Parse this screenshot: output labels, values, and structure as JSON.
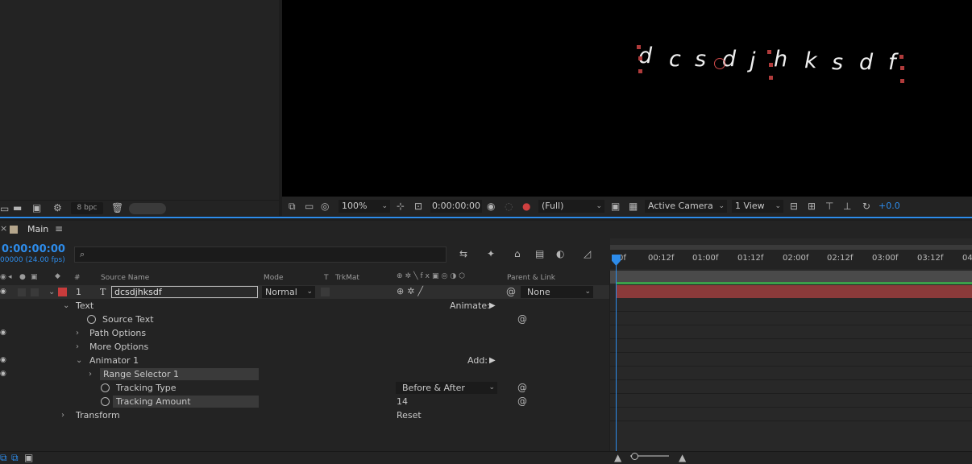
{
  "project": {
    "bpc_label": "8 bpc"
  },
  "viewer": {
    "text_chars": [
      "d",
      "c",
      "s",
      "d",
      "j",
      "h",
      "k",
      "s",
      "d",
      "f"
    ],
    "toolbar": {
      "zoom": "100%",
      "timecode": "0:00:00:00",
      "resolution": "(Full)",
      "camera": "Active Camera",
      "views": "1 View",
      "exposure": "+0.0"
    }
  },
  "timeline": {
    "tab_label": "Main",
    "current_time": "0:00:00:00",
    "fps_label": "00000 (24.00 fps)",
    "search_placeholder": "",
    "columns": {
      "hash": "#",
      "source_name": "Source Name",
      "mode": "Mode",
      "t": "T",
      "trkmat": "TrkMat",
      "parent": "Parent & Link"
    },
    "layer": {
      "number": "1",
      "type_glyph": "T",
      "name": "dcsdjhksdf",
      "mode": "Normal",
      "parent": "None"
    },
    "properties": {
      "text": "Text",
      "animate_label": "Animate:",
      "source_text": "Source Text",
      "path_options": "Path Options",
      "more_options": "More Options",
      "animator": "Animator 1",
      "add_label": "Add:",
      "range_selector": "Range Selector 1",
      "tracking_type": "Tracking Type",
      "tracking_type_value": "Before & After",
      "tracking_amount": "Tracking Amount",
      "tracking_amount_value": "14",
      "transform": "Transform",
      "reset_label": "Reset"
    },
    "ruler_labels": [
      "0f",
      "00:12f",
      "01:00f",
      "01:12f",
      "02:00f",
      "02:12f",
      "03:00f",
      "03:12f",
      "04"
    ]
  },
  "colors": {
    "accent": "#2d8ceb",
    "layer_label": "#c83c3c",
    "layer_bar": "#8b3a3a"
  }
}
